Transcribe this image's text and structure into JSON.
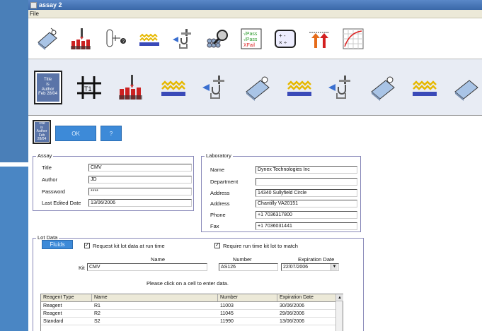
{
  "window": {
    "title": "assay 2"
  },
  "menu": {
    "file": "File"
  },
  "toolbar2": {
    "title_box": [
      "Title",
      "is",
      "Author",
      "Feb 28/04"
    ],
    "t1_label": "T1"
  },
  "actions": {
    "small_title": [
      "Title",
      "is",
      "Author",
      "Feb 28/04"
    ],
    "ok": "OK",
    "help": "?"
  },
  "assay": {
    "legend": "Assay",
    "title_label": "Title",
    "title_value": "CMV",
    "author_label": "Author",
    "author_value": "JD",
    "password_label": "Password",
    "password_value": "****",
    "last_edited_label": "Last Edited Date",
    "last_edited_value": "13/06/2006"
  },
  "laboratory": {
    "legend": "Laboratory",
    "name_label": "Name",
    "name_value": "Dynex Technologies Inc",
    "department_label": "Department",
    "department_value": "",
    "address1_label": "Address",
    "address1_value": "14340 Sullyfield Circle",
    "address2_label": "Address",
    "address2_value": "Chantilly VA20151",
    "phone_label": "Phone",
    "phone_value": "+1 7036317800",
    "fax_label": "Fax",
    "fax_value": "+1 7036031441"
  },
  "lot": {
    "legend": "Lot Data",
    "fluids_btn": "Fluids",
    "request_label": "Request kit lot data at run time",
    "require_label": "Require run time kit lot to match",
    "col_name": "Name",
    "col_number": "Number",
    "col_expiration": "Expiration Date",
    "kit_label": "Kit",
    "kit_name": "CMV",
    "kit_number": "AS126",
    "kit_expiration": "22/07/2006",
    "instruction": "Please click on a cell to enter data.",
    "table_headers": [
      "Reagent Type",
      "Name",
      "Number",
      "Expiration Date"
    ],
    "rows": [
      [
        "Reagent",
        "R1",
        "11003",
        "30/06/2006"
      ],
      [
        "Reagent",
        "R2",
        "11045",
        "29/06/2006"
      ],
      [
        "Standard",
        "S2",
        "11990",
        "13/06/2006"
      ]
    ]
  }
}
